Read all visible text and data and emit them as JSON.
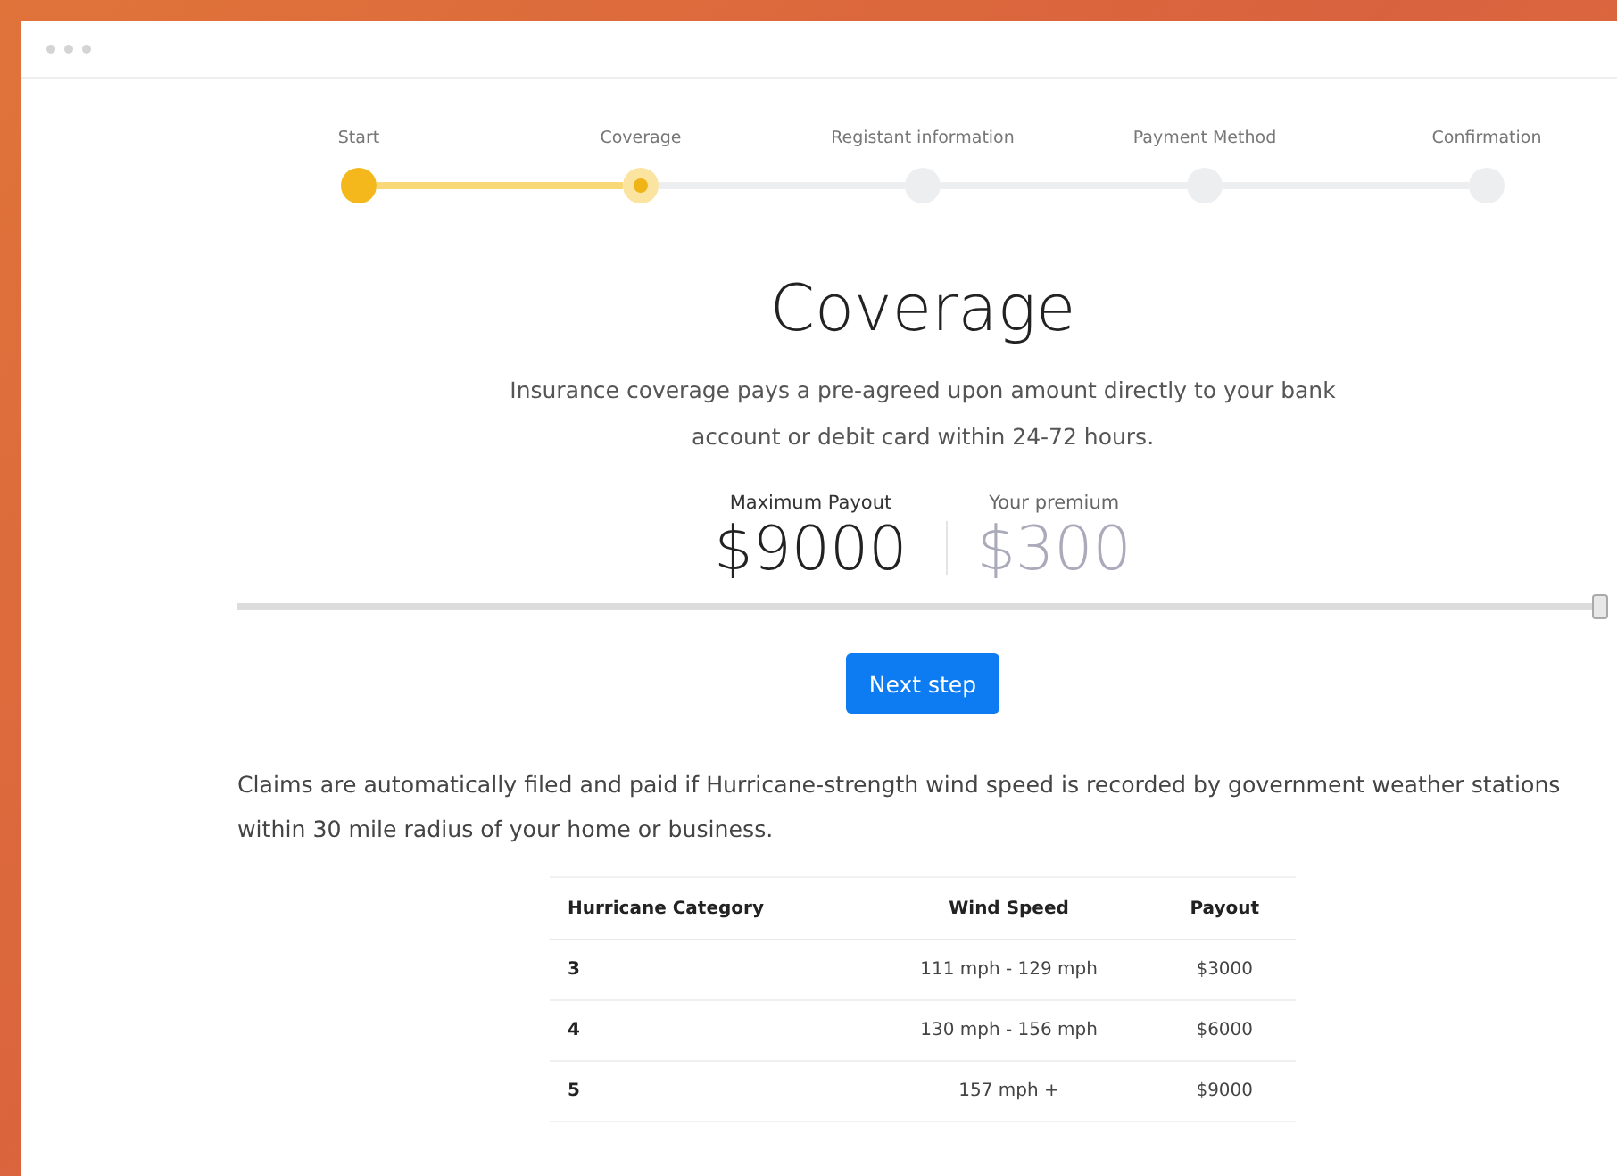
{
  "steps": [
    {
      "label": "Start",
      "completed": true,
      "selected": false
    },
    {
      "label": "Coverage",
      "completed": false,
      "selected": true
    },
    {
      "label": "Registant information",
      "completed": false,
      "selected": false
    },
    {
      "label": "Payment Method",
      "completed": false,
      "selected": false
    },
    {
      "label": "Confirmation",
      "completed": false,
      "selected": false
    }
  ],
  "title": "Coverage",
  "intro": "Insurance coverage pays a pre-agreed upon amount directly to your bank account or debit card within 24-72 hours.",
  "maximum_payout": {
    "label": "Maximum Payout",
    "value": "$9000"
  },
  "premium": {
    "label": "Your premium",
    "value": "$300"
  },
  "payout_slider": {
    "level": 1
  },
  "next_button": "Next step",
  "claims_text": "Claims are automatically filed and paid if Hurricane-strength wind speed is recorded by government weather stations within 30 mile radius of your home or business.",
  "table": {
    "columns": [
      "Hurricane Category",
      "Wind Speed",
      "Payout"
    ],
    "rows": [
      [
        "3",
        "111 mph - 129 mph",
        "$3000"
      ],
      [
        "4",
        "130 mph - 156 mph",
        "$6000"
      ],
      [
        "5",
        "157 mph +",
        "$9000"
      ]
    ]
  }
}
